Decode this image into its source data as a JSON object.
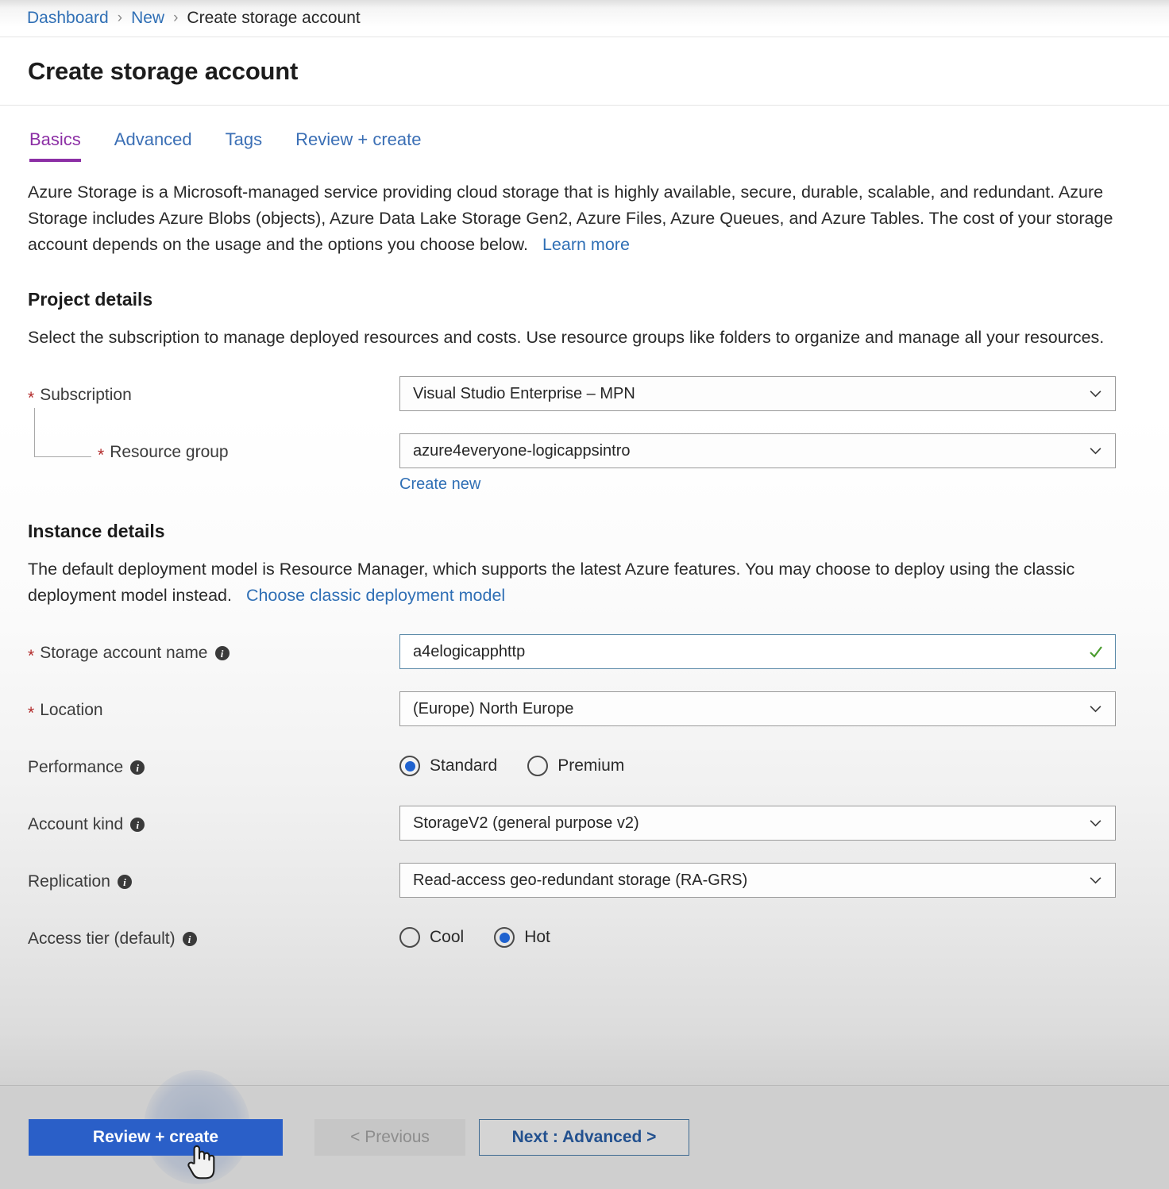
{
  "breadcrumb": {
    "items": [
      {
        "label": "Dashboard",
        "type": "link"
      },
      {
        "label": "New",
        "type": "link"
      },
      {
        "label": "Create storage account",
        "type": "current"
      }
    ],
    "separator": "›"
  },
  "header": {
    "title": "Create storage account"
  },
  "tabs": [
    {
      "label": "Basics",
      "active": true
    },
    {
      "label": "Advanced",
      "active": false
    },
    {
      "label": "Tags",
      "active": false
    },
    {
      "label": "Review + create",
      "active": false
    }
  ],
  "intro": {
    "text": "Azure Storage is a Microsoft-managed service providing cloud storage that is highly available, secure, durable, scalable, and redundant. Azure Storage includes Azure Blobs (objects), Azure Data Lake Storage Gen2, Azure Files, Azure Queues, and Azure Tables. The cost of your storage account depends on the usage and the options you choose below.",
    "learn_more": "Learn more"
  },
  "project_details": {
    "heading": "Project details",
    "description": "Select the subscription to manage deployed resources and costs. Use resource groups like folders to organize and manage all your resources.",
    "subscription": {
      "label": "Subscription",
      "required": true,
      "value": "Visual Studio Enterprise – MPN"
    },
    "resource_group": {
      "label": "Resource group",
      "required": true,
      "value": "azure4everyone-logicappsintro",
      "create_new": "Create new"
    }
  },
  "instance_details": {
    "heading": "Instance details",
    "description": "The default deployment model is Resource Manager, which supports the latest Azure features. You may choose to deploy using the classic deployment model instead.",
    "classic_link": "Choose classic deployment model",
    "storage_account_name": {
      "label": "Storage account name",
      "required": true,
      "has_info": true,
      "value": "a4elogicapphttp",
      "valid": true
    },
    "location": {
      "label": "Location",
      "required": true,
      "value": "(Europe) North Europe"
    },
    "performance": {
      "label": "Performance",
      "has_info": true,
      "options": [
        {
          "label": "Standard",
          "selected": true
        },
        {
          "label": "Premium",
          "selected": false
        }
      ]
    },
    "account_kind": {
      "label": "Account kind",
      "has_info": true,
      "value": "StorageV2 (general purpose v2)"
    },
    "replication": {
      "label": "Replication",
      "has_info": true,
      "value": "Read-access geo-redundant storage (RA-GRS)"
    },
    "access_tier": {
      "label": "Access tier (default)",
      "has_info": true,
      "options": [
        {
          "label": "Cool",
          "selected": false
        },
        {
          "label": "Hot",
          "selected": true
        }
      ]
    }
  },
  "footer": {
    "review_create": "Review + create",
    "previous": "< Previous",
    "next": "Next : Advanced >"
  },
  "colors": {
    "accent_tab": "#8c2fa5",
    "link": "#2f6fb5",
    "primary_button": "#2a5fc8",
    "required_star": "#b22a2a",
    "radio_fill": "#1f62cf",
    "valid_check": "#4a9c2e",
    "focus_border": "#5b8aa8"
  }
}
